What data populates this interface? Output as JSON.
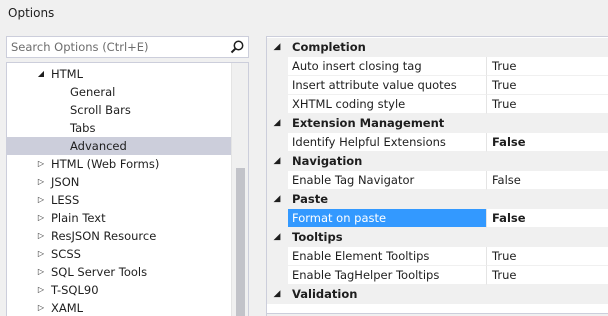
{
  "window": {
    "title": "Options"
  },
  "search": {
    "placeholder": "Search Options (Ctrl+E)"
  },
  "tree": {
    "items": [
      {
        "label": "HTML",
        "arrow": "◢",
        "expanded": true,
        "selected": false
      },
      {
        "label": "General",
        "arrow": "",
        "selected": false
      },
      {
        "label": "Scroll Bars",
        "arrow": "",
        "selected": false
      },
      {
        "label": "Tabs",
        "arrow": "",
        "selected": false
      },
      {
        "label": "Advanced",
        "arrow": "",
        "selected": true
      },
      {
        "label": "HTML (Web Forms)",
        "arrow": "▷",
        "selected": false
      },
      {
        "label": "JSON",
        "arrow": "▷",
        "selected": false
      },
      {
        "label": "LESS",
        "arrow": "▷",
        "selected": false
      },
      {
        "label": "Plain Text",
        "arrow": "▷",
        "selected": false
      },
      {
        "label": "ResJSON Resource",
        "arrow": "▷",
        "selected": false
      },
      {
        "label": "SCSS",
        "arrow": "▷",
        "selected": false
      },
      {
        "label": "SQL Server Tools",
        "arrow": "▷",
        "selected": false
      },
      {
        "label": "T-SQL90",
        "arrow": "▷",
        "selected": false
      },
      {
        "label": "XAML",
        "arrow": "▷",
        "selected": false
      }
    ]
  },
  "grid": {
    "categories": [
      {
        "label": "Completion",
        "arrow": "◢",
        "props": [
          {
            "name": "Auto insert closing tag",
            "value": "True",
            "bold": false,
            "selected": false
          },
          {
            "name": "Insert attribute value quotes",
            "value": "True",
            "bold": false,
            "selected": false
          },
          {
            "name": "XHTML coding style",
            "value": "True",
            "bold": false,
            "selected": false
          }
        ]
      },
      {
        "label": "Extension Management",
        "arrow": "◢",
        "props": [
          {
            "name": "Identify Helpful Extensions",
            "value": "False",
            "bold": true,
            "selected": false
          }
        ]
      },
      {
        "label": "Navigation",
        "arrow": "◢",
        "props": [
          {
            "name": "Enable Tag Navigator",
            "value": "False",
            "bold": false,
            "selected": false
          }
        ]
      },
      {
        "label": "Paste",
        "arrow": "◢",
        "props": [
          {
            "name": "Format on paste",
            "value": "False",
            "bold": true,
            "selected": true
          }
        ]
      },
      {
        "label": "Tooltips",
        "arrow": "◢",
        "props": [
          {
            "name": "Enable Element Tooltips",
            "value": "True",
            "bold": false,
            "selected": false
          },
          {
            "name": "Enable TagHelper Tooltips",
            "value": "True",
            "bold": false,
            "selected": false
          }
        ]
      },
      {
        "label": "Validation",
        "arrow": "◢",
        "props": []
      }
    ]
  },
  "colors": {
    "selection": "#3399ff",
    "tree_selection": "#cccedb",
    "border": "#cccedb",
    "background": "#f0f0f0"
  },
  "icons": {
    "search": "search-icon",
    "expanded": "expanded-triangle-icon",
    "collapsed": "collapsed-triangle-icon"
  }
}
